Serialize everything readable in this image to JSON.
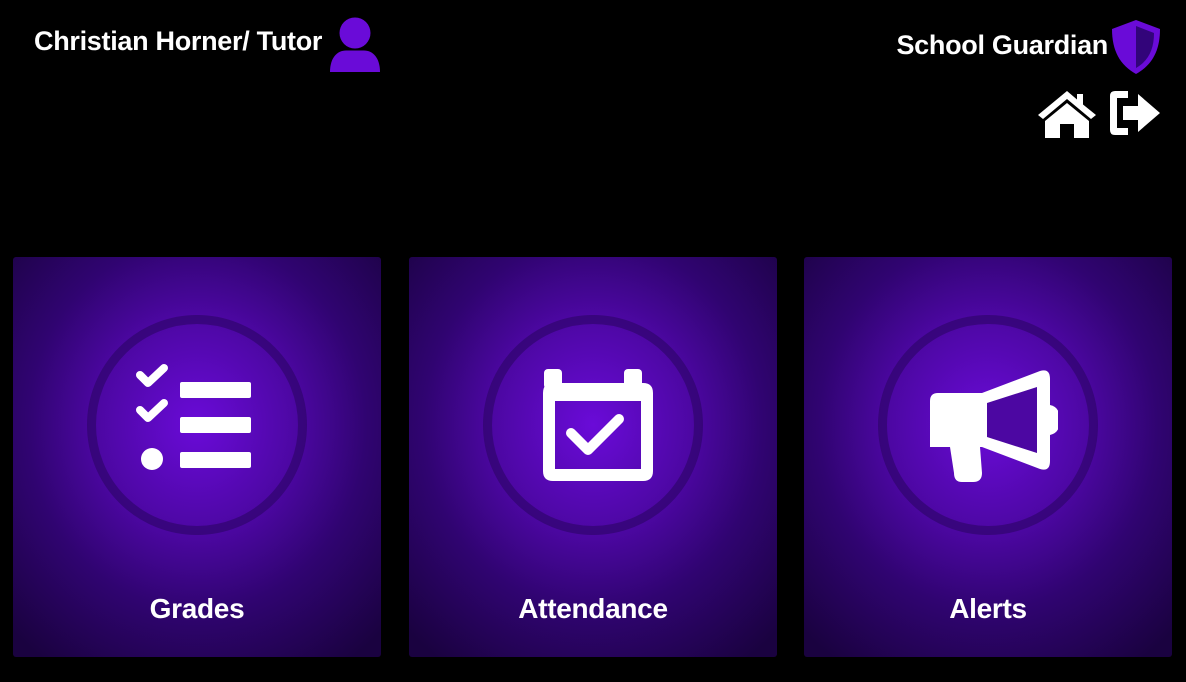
{
  "header": {
    "user_name": "Christian Horner/ Tutor",
    "user_icon": "user-icon",
    "brand_name": "School Guardian",
    "brand_icon": "shield-icon"
  },
  "nav": {
    "home_icon": "home-icon",
    "logout_icon": "sign-out-icon"
  },
  "tiles": [
    {
      "label": "Grades",
      "icon": "checklist-icon"
    },
    {
      "label": "Attendance",
      "icon": "calendar-check-icon"
    },
    {
      "label": "Alerts",
      "icon": "megaphone-icon"
    }
  ],
  "colors": {
    "background": "#000000",
    "accent": "#6a0bd8",
    "text": "#ffffff"
  }
}
